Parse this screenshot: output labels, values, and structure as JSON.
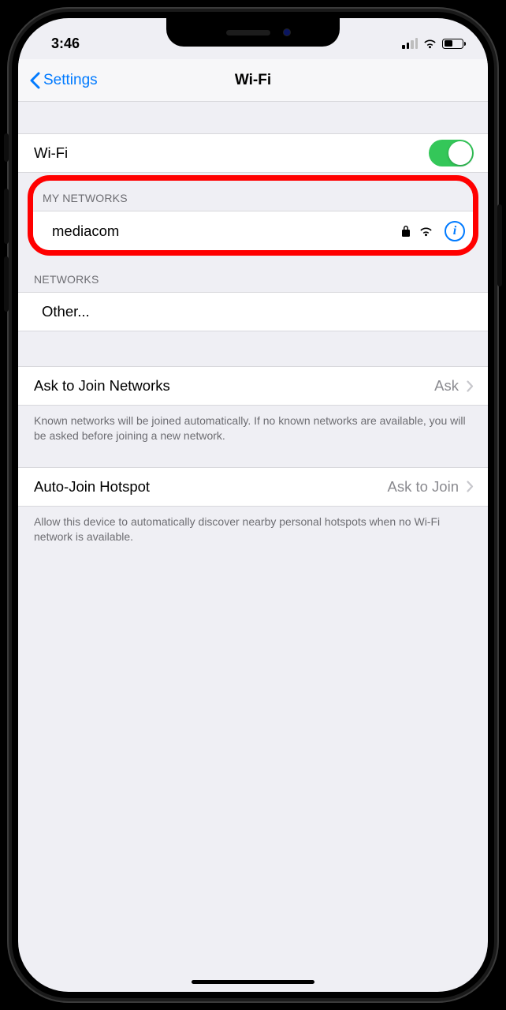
{
  "status": {
    "time": "3:46",
    "signal_level": 2
  },
  "nav": {
    "back_label": "Settings",
    "title": "Wi-Fi"
  },
  "wifi_toggle": {
    "label": "Wi-Fi",
    "on": true
  },
  "my_networks": {
    "header": "MY NETWORKS",
    "items": [
      {
        "name": "mediacom",
        "secure": true
      }
    ]
  },
  "networks": {
    "header": "NETWORKS",
    "other_label": "Other..."
  },
  "ask_join": {
    "label": "Ask to Join Networks",
    "value": "Ask",
    "footer": "Known networks will be joined automatically. If no known networks are available, you will be asked before joining a new network."
  },
  "auto_join": {
    "label": "Auto-Join Hotspot",
    "value": "Ask to Join",
    "footer": "Allow this device to automatically discover nearby personal hotspots when no Wi-Fi network is available."
  }
}
